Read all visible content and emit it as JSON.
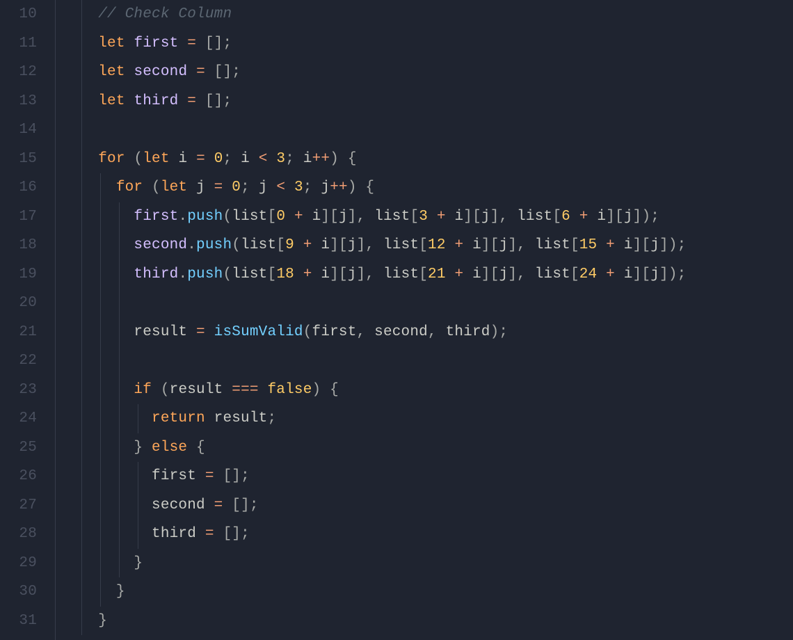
{
  "lineStart": 10,
  "lines": [
    {
      "n": 10,
      "indent": 2,
      "tokens": [
        [
          "comment",
          "// Check Column"
        ]
      ]
    },
    {
      "n": 11,
      "indent": 2,
      "tokens": [
        [
          "keyword",
          "let "
        ],
        [
          "ident",
          "first"
        ],
        [
          "punct",
          " "
        ],
        [
          "op",
          "="
        ],
        [
          "punct",
          " []"
        ],
        [
          "punct",
          ";"
        ]
      ]
    },
    {
      "n": 12,
      "indent": 2,
      "tokens": [
        [
          "keyword",
          "let "
        ],
        [
          "ident",
          "second"
        ],
        [
          "punct",
          " "
        ],
        [
          "op",
          "="
        ],
        [
          "punct",
          " []"
        ],
        [
          "punct",
          ";"
        ]
      ]
    },
    {
      "n": 13,
      "indent": 2,
      "tokens": [
        [
          "keyword",
          "let "
        ],
        [
          "ident",
          "third"
        ],
        [
          "punct",
          " "
        ],
        [
          "op",
          "="
        ],
        [
          "punct",
          " []"
        ],
        [
          "punct",
          ";"
        ]
      ]
    },
    {
      "n": 14,
      "indent": 2,
      "tokens": []
    },
    {
      "n": 15,
      "indent": 2,
      "tokens": [
        [
          "keyword",
          "for"
        ],
        [
          "punct",
          " ("
        ],
        [
          "keyword",
          "let "
        ],
        [
          "identu",
          "i"
        ],
        [
          "punct",
          " "
        ],
        [
          "op",
          "="
        ],
        [
          "punct",
          " "
        ],
        [
          "num",
          "0"
        ],
        [
          "punct",
          "; "
        ],
        [
          "identu",
          "i"
        ],
        [
          "punct",
          " "
        ],
        [
          "op",
          "<"
        ],
        [
          "punct",
          " "
        ],
        [
          "num",
          "3"
        ],
        [
          "punct",
          "; "
        ],
        [
          "identu",
          "i"
        ],
        [
          "op",
          "++"
        ],
        [
          "punct",
          ") {"
        ]
      ]
    },
    {
      "n": 16,
      "indent": 3,
      "tokens": [
        [
          "keyword",
          "for"
        ],
        [
          "punct",
          " ("
        ],
        [
          "keyword",
          "let "
        ],
        [
          "identu",
          "j"
        ],
        [
          "punct",
          " "
        ],
        [
          "op",
          "="
        ],
        [
          "punct",
          " "
        ],
        [
          "num",
          "0"
        ],
        [
          "punct",
          "; "
        ],
        [
          "identu",
          "j"
        ],
        [
          "punct",
          " "
        ],
        [
          "op",
          "<"
        ],
        [
          "punct",
          " "
        ],
        [
          "num",
          "3"
        ],
        [
          "punct",
          "; "
        ],
        [
          "identu",
          "j"
        ],
        [
          "op",
          "++"
        ],
        [
          "punct",
          ") {"
        ]
      ]
    },
    {
      "n": 17,
      "indent": 4,
      "tokens": [
        [
          "ident",
          "first"
        ],
        [
          "punct",
          "."
        ],
        [
          "func",
          "push"
        ],
        [
          "punct",
          "("
        ],
        [
          "identu",
          "list"
        ],
        [
          "punct",
          "["
        ],
        [
          "num",
          "0"
        ],
        [
          "punct",
          " "
        ],
        [
          "op",
          "+"
        ],
        [
          "punct",
          " "
        ],
        [
          "identu",
          "i"
        ],
        [
          "punct",
          "]["
        ],
        [
          "identu",
          "j"
        ],
        [
          "punct",
          "], "
        ],
        [
          "identu",
          "list"
        ],
        [
          "punct",
          "["
        ],
        [
          "num",
          "3"
        ],
        [
          "punct",
          " "
        ],
        [
          "op",
          "+"
        ],
        [
          "punct",
          " "
        ],
        [
          "identu",
          "i"
        ],
        [
          "punct",
          "]["
        ],
        [
          "identu",
          "j"
        ],
        [
          "punct",
          "], "
        ],
        [
          "identu",
          "list"
        ],
        [
          "punct",
          "["
        ],
        [
          "num",
          "6"
        ],
        [
          "punct",
          " "
        ],
        [
          "op",
          "+"
        ],
        [
          "punct",
          " "
        ],
        [
          "identu",
          "i"
        ],
        [
          "punct",
          "]["
        ],
        [
          "identu",
          "j"
        ],
        [
          "punct",
          "]);"
        ]
      ]
    },
    {
      "n": 18,
      "indent": 4,
      "tokens": [
        [
          "ident",
          "second"
        ],
        [
          "punct",
          "."
        ],
        [
          "func",
          "push"
        ],
        [
          "punct",
          "("
        ],
        [
          "identu",
          "list"
        ],
        [
          "punct",
          "["
        ],
        [
          "num",
          "9"
        ],
        [
          "punct",
          " "
        ],
        [
          "op",
          "+"
        ],
        [
          "punct",
          " "
        ],
        [
          "identu",
          "i"
        ],
        [
          "punct",
          "]["
        ],
        [
          "identu",
          "j"
        ],
        [
          "punct",
          "], "
        ],
        [
          "identu",
          "list"
        ],
        [
          "punct",
          "["
        ],
        [
          "num",
          "12"
        ],
        [
          "punct",
          " "
        ],
        [
          "op",
          "+"
        ],
        [
          "punct",
          " "
        ],
        [
          "identu",
          "i"
        ],
        [
          "punct",
          "]["
        ],
        [
          "identu",
          "j"
        ],
        [
          "punct",
          "], "
        ],
        [
          "identu",
          "list"
        ],
        [
          "punct",
          "["
        ],
        [
          "num",
          "15"
        ],
        [
          "punct",
          " "
        ],
        [
          "op",
          "+"
        ],
        [
          "punct",
          " "
        ],
        [
          "identu",
          "i"
        ],
        [
          "punct",
          "]["
        ],
        [
          "identu",
          "j"
        ],
        [
          "punct",
          "]);"
        ]
      ]
    },
    {
      "n": 19,
      "indent": 4,
      "tokens": [
        [
          "ident",
          "third"
        ],
        [
          "punct",
          "."
        ],
        [
          "func",
          "push"
        ],
        [
          "punct",
          "("
        ],
        [
          "identu",
          "list"
        ],
        [
          "punct",
          "["
        ],
        [
          "num",
          "18"
        ],
        [
          "punct",
          " "
        ],
        [
          "op",
          "+"
        ],
        [
          "punct",
          " "
        ],
        [
          "identu",
          "i"
        ],
        [
          "punct",
          "]["
        ],
        [
          "identu",
          "j"
        ],
        [
          "punct",
          "], "
        ],
        [
          "identu",
          "list"
        ],
        [
          "punct",
          "["
        ],
        [
          "num",
          "21"
        ],
        [
          "punct",
          " "
        ],
        [
          "op",
          "+"
        ],
        [
          "punct",
          " "
        ],
        [
          "identu",
          "i"
        ],
        [
          "punct",
          "]["
        ],
        [
          "identu",
          "j"
        ],
        [
          "punct",
          "], "
        ],
        [
          "identu",
          "list"
        ],
        [
          "punct",
          "["
        ],
        [
          "num",
          "24"
        ],
        [
          "punct",
          " "
        ],
        [
          "op",
          "+"
        ],
        [
          "punct",
          " "
        ],
        [
          "identu",
          "i"
        ],
        [
          "punct",
          "]["
        ],
        [
          "identu",
          "j"
        ],
        [
          "punct",
          "]);"
        ]
      ]
    },
    {
      "n": 20,
      "indent": 4,
      "tokens": []
    },
    {
      "n": 21,
      "indent": 4,
      "tokens": [
        [
          "identu",
          "result"
        ],
        [
          "punct",
          " "
        ],
        [
          "op",
          "="
        ],
        [
          "punct",
          " "
        ],
        [
          "func",
          "isSumValid"
        ],
        [
          "punct",
          "("
        ],
        [
          "identu",
          "first"
        ],
        [
          "punct",
          ", "
        ],
        [
          "identu",
          "second"
        ],
        [
          "punct",
          ", "
        ],
        [
          "identu",
          "third"
        ],
        [
          "punct",
          ");"
        ]
      ]
    },
    {
      "n": 22,
      "indent": 4,
      "tokens": []
    },
    {
      "n": 23,
      "indent": 4,
      "tokens": [
        [
          "keyword",
          "if"
        ],
        [
          "punct",
          " ("
        ],
        [
          "identu",
          "result"
        ],
        [
          "punct",
          " "
        ],
        [
          "op",
          "==="
        ],
        [
          "punct",
          " "
        ],
        [
          "const",
          "false"
        ],
        [
          "punct",
          ") {"
        ]
      ]
    },
    {
      "n": 24,
      "indent": 5,
      "tokens": [
        [
          "keyword",
          "return"
        ],
        [
          "punct",
          " "
        ],
        [
          "identu",
          "result"
        ],
        [
          "punct",
          ";"
        ]
      ]
    },
    {
      "n": 25,
      "indent": 4,
      "tokens": [
        [
          "punct",
          "} "
        ],
        [
          "keyword",
          "else"
        ],
        [
          "punct",
          " {"
        ]
      ]
    },
    {
      "n": 26,
      "indent": 5,
      "tokens": [
        [
          "identu",
          "first"
        ],
        [
          "punct",
          " "
        ],
        [
          "op",
          "="
        ],
        [
          "punct",
          " []"
        ],
        [
          "punct",
          ";"
        ]
      ]
    },
    {
      "n": 27,
      "indent": 5,
      "tokens": [
        [
          "identu",
          "second"
        ],
        [
          "punct",
          " "
        ],
        [
          "op",
          "="
        ],
        [
          "punct",
          " []"
        ],
        [
          "punct",
          ";"
        ]
      ]
    },
    {
      "n": 28,
      "indent": 5,
      "tokens": [
        [
          "identu",
          "third"
        ],
        [
          "punct",
          " "
        ],
        [
          "op",
          "="
        ],
        [
          "punct",
          " []"
        ],
        [
          "punct",
          ";"
        ]
      ]
    },
    {
      "n": 29,
      "indent": 4,
      "tokens": [
        [
          "punct",
          "}"
        ]
      ]
    },
    {
      "n": 30,
      "indent": 3,
      "tokens": [
        [
          "punct",
          "}"
        ]
      ]
    },
    {
      "n": 31,
      "indent": 2,
      "tokens": [
        [
          "punct",
          "}"
        ]
      ]
    }
  ]
}
